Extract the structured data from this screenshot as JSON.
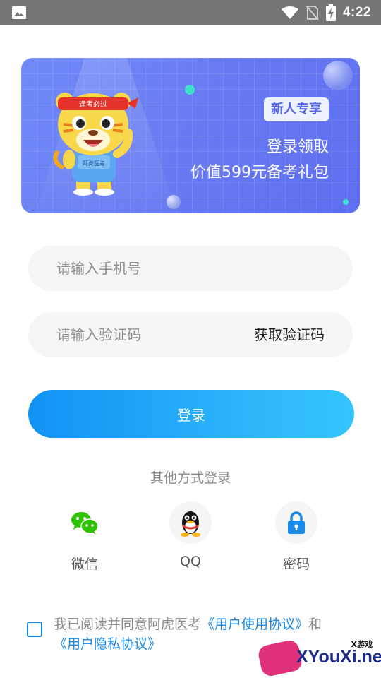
{
  "status_bar": {
    "time": "4:22",
    "icons": [
      "image-icon",
      "wifi-icon",
      "no-sim-icon",
      "battery-charging-icon"
    ]
  },
  "banner": {
    "badge": "新人专享",
    "line1": "登录领取",
    "line2": "价值599元备考礼包",
    "mascot_headband_text": "逢考必过",
    "mascot_shirt_text": "阿虎医考"
  },
  "form": {
    "phone_placeholder": "请输入手机号",
    "code_placeholder": "请输入验证码",
    "get_code_label": "获取验证码",
    "login_label": "登录"
  },
  "other_login": {
    "title": "其他方式登录",
    "methods": [
      {
        "label": "微信",
        "icon": "wechat-icon"
      },
      {
        "label": "QQ",
        "icon": "qq-icon"
      },
      {
        "label": "密码",
        "icon": "lock-icon"
      }
    ]
  },
  "agreement": {
    "prefix": "我已阅读并同意阿虎医考",
    "user_agreement": "《用户使用协议》",
    "and": "和",
    "privacy_agreement": "《用户隐私协议》"
  },
  "watermark": {
    "small": "X游戏",
    "big": "XYouXi.net"
  },
  "colors": {
    "primary_blue": "#1a8ae8",
    "banner_blue": "#6a7cf2",
    "wechat_green": "#2dc100",
    "qq_black": "#111111"
  }
}
